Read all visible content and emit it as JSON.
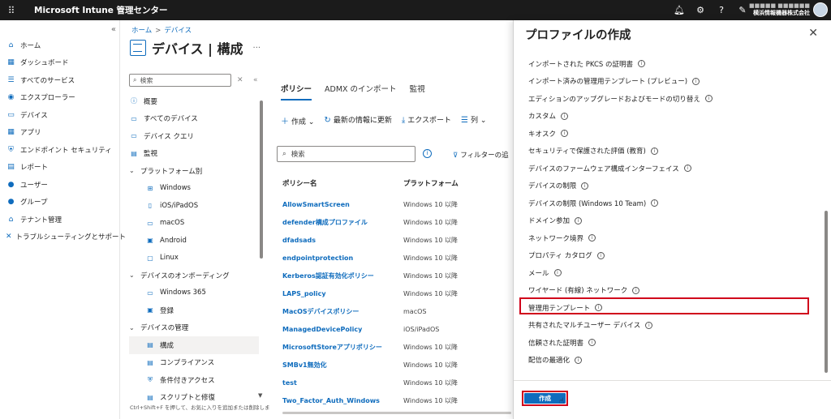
{
  "header": {
    "app_title": "Microsoft Intune 管理センター",
    "account_user": "■■■■■ ■■■■■■",
    "account_company": "横浜情報機器株式会社"
  },
  "leftnav": {
    "items": [
      {
        "label": "ホーム",
        "icon": "home-icon"
      },
      {
        "label": "ダッシュボード",
        "icon": "dashboard-icon"
      },
      {
        "label": "すべてのサービス",
        "icon": "list-icon"
      },
      {
        "label": "エクスプローラー",
        "icon": "explorer-icon"
      },
      {
        "label": "デバイス",
        "icon": "device-icon"
      },
      {
        "label": "アプリ",
        "icon": "apps-icon"
      },
      {
        "label": "エンドポイント セキュリティ",
        "icon": "shield-icon"
      },
      {
        "label": "レポート",
        "icon": "report-icon"
      },
      {
        "label": "ユーザー",
        "icon": "user-icon"
      },
      {
        "label": "グループ",
        "icon": "group-icon"
      },
      {
        "label": "テナント管理",
        "icon": "tenant-icon"
      },
      {
        "label": "トラブルシューティングとサポート",
        "icon": "wrench-icon"
      }
    ]
  },
  "breadcrumb": {
    "home": "ホーム",
    "current": "デバイス"
  },
  "page": {
    "title": "デバイス | 構成",
    "more": "···"
  },
  "resource_menu": {
    "search_placeholder": "検索",
    "items": [
      {
        "label": "概要",
        "kind": "item"
      },
      {
        "label": "すべてのデバイス",
        "kind": "item"
      },
      {
        "label": "デバイス クエリ",
        "kind": "item"
      },
      {
        "label": "監視",
        "kind": "item"
      },
      {
        "label": "プラットフォーム別",
        "kind": "group"
      },
      {
        "label": "Windows",
        "kind": "sub"
      },
      {
        "label": "iOS/iPadOS",
        "kind": "sub"
      },
      {
        "label": "macOS",
        "kind": "sub"
      },
      {
        "label": "Android",
        "kind": "sub"
      },
      {
        "label": "Linux",
        "kind": "sub"
      },
      {
        "label": "デバイスのオンボーディング",
        "kind": "group"
      },
      {
        "label": "Windows 365",
        "kind": "sub"
      },
      {
        "label": "登録",
        "kind": "sub"
      },
      {
        "label": "デバイスの管理",
        "kind": "group"
      },
      {
        "label": "構成",
        "kind": "sub",
        "active": true
      },
      {
        "label": "コンプライアンス",
        "kind": "sub"
      },
      {
        "label": "条件付きアクセス",
        "kind": "sub"
      },
      {
        "label": "スクリプトと修復",
        "kind": "sub"
      }
    ],
    "hint": "Ctrl+Shift+F を押して、お気に入りを追加または削除しま"
  },
  "content": {
    "tabs": [
      {
        "label": "ポリシー",
        "active": true
      },
      {
        "label": "ADMX のインポート",
        "active": false
      },
      {
        "label": "監視",
        "active": false
      }
    ],
    "commands": {
      "create": "作成",
      "refresh": "最新の情報に更新",
      "export": "エクスポート",
      "columns": "列"
    },
    "search_placeholder": "検索",
    "filter_label": "フィルターの追",
    "columns": [
      "ポリシー名",
      "プラットフォーム"
    ],
    "rows": [
      {
        "name": "AllowSmartScreen",
        "platform": "Windows 10 以降"
      },
      {
        "name": "defender構成プロファイル",
        "platform": "Windows 10 以降"
      },
      {
        "name": "dfadsads",
        "platform": "Windows 10 以降"
      },
      {
        "name": "endpointprotection",
        "platform": "Windows 10 以降"
      },
      {
        "name": "Kerberos認証有効化ポリシー",
        "platform": "Windows 10 以降"
      },
      {
        "name": "LAPS_policy",
        "platform": "Windows 10 以降"
      },
      {
        "name": "MacOSデバイスポリシー",
        "platform": "macOS"
      },
      {
        "name": "ManagedDevicePolicy",
        "platform": "iOS/iPadOS"
      },
      {
        "name": "MicrosoftStoreアプリポリシー",
        "platform": "Windows 10 以降"
      },
      {
        "name": "SMBv1無効化",
        "platform": "Windows 10 以降"
      },
      {
        "name": "test",
        "platform": "Windows 10 以降"
      },
      {
        "name": "Two_Factor_Auth_Windows",
        "platform": "Windows 10 以降"
      }
    ]
  },
  "blade": {
    "title": "プロファイルの作成",
    "items": [
      "インポートされた PKCS の証明書",
      "インポート済みの管理用テンプレート (プレビュー)",
      "エディションのアップグレードおよびモードの切り替え",
      "カスタム",
      "キオスク",
      "セキュリティで保護された評価 (教育)",
      "デバイスのファームウェア構成インターフェイス",
      "デバイスの制限",
      "デバイスの制限 (Windows 10 Team)",
      "ドメイン参加",
      "ネットワーク境界",
      "プロパティ カタログ",
      "メール",
      "ワイヤード (有線) ネットワーク",
      "管理用テンプレート",
      "共有されたマルチユーザー デバイス",
      "信頼された証明書",
      "配信の最適化"
    ],
    "highlighted_item": "管理用テンプレート",
    "create_button": "作成"
  },
  "colors": {
    "accent": "#0f6cbd",
    "highlight": "#d0021b",
    "topbar": "#1b1b1b"
  }
}
